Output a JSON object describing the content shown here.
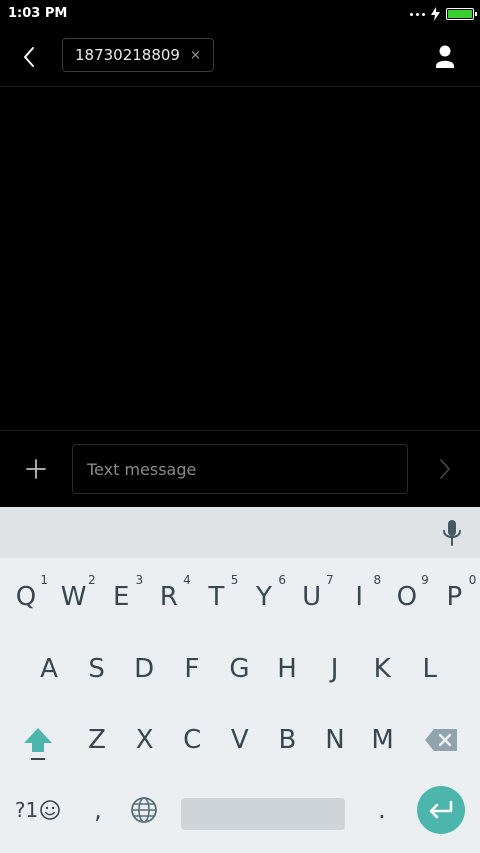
{
  "status": {
    "time": "1:03 PM"
  },
  "header": {
    "recipient": "18730218809",
    "remove_symbol": "×"
  },
  "compose": {
    "placeholder": "Text message"
  },
  "keyboard": {
    "row1": [
      {
        "label": "Q",
        "hint": "1"
      },
      {
        "label": "W",
        "hint": "2"
      },
      {
        "label": "E",
        "hint": "3"
      },
      {
        "label": "R",
        "hint": "4"
      },
      {
        "label": "T",
        "hint": "5"
      },
      {
        "label": "Y",
        "hint": "6"
      },
      {
        "label": "U",
        "hint": "7"
      },
      {
        "label": "I",
        "hint": "8"
      },
      {
        "label": "O",
        "hint": "9"
      },
      {
        "label": "P",
        "hint": "0"
      }
    ],
    "row2": [
      "A",
      "S",
      "D",
      "F",
      "G",
      "H",
      "J",
      "K",
      "L"
    ],
    "row3": [
      "Z",
      "X",
      "C",
      "V",
      "B",
      "N",
      "M"
    ],
    "symbols_label": "?1",
    "comma": ",",
    "period": "."
  },
  "colors": {
    "accent": "#4db6ac",
    "battery": "#37d12f",
    "key_text": "#37474f",
    "keyboard_bg": "#eceff1"
  },
  "battery_level": 1.0
}
